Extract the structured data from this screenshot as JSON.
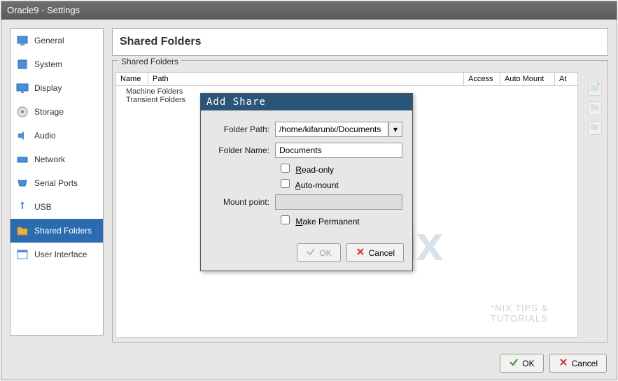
{
  "window": {
    "title": "Oracle9 - Settings"
  },
  "sidebar": {
    "items": [
      {
        "label": "General"
      },
      {
        "label": "System"
      },
      {
        "label": "Display"
      },
      {
        "label": "Storage"
      },
      {
        "label": "Audio"
      },
      {
        "label": "Network"
      },
      {
        "label": "Serial Ports"
      },
      {
        "label": "USB"
      },
      {
        "label": "Shared Folders"
      },
      {
        "label": "User Interface"
      }
    ]
  },
  "page": {
    "title": "Shared Folders",
    "groupbox_label": "Shared Folders",
    "columns": {
      "name": "Name",
      "path": "Path",
      "access": "Access",
      "automount": "Auto Mount",
      "at": "At"
    },
    "tree": {
      "machine": "Machine Folders",
      "transient": "Transient Folders"
    }
  },
  "dialog": {
    "title": "Add Share",
    "folder_path_label": "Folder Path:",
    "folder_path_value": "/home/kifarunix/Documents",
    "folder_name_label": "Folder Name:",
    "folder_name_value": "Documents",
    "readonly_label": "Read-only",
    "automount_label": "Auto-mount",
    "mountpoint_label": "Mount point:",
    "mountpoint_value": "",
    "permanent_label": "Make Permanent",
    "ok": "OK",
    "cancel": "Cancel"
  },
  "footer": {
    "ok": "OK",
    "cancel": "Cancel"
  },
  "watermark": {
    "main": "Kifarunix",
    "sub": "*NIX TIPS & TUTORIALS"
  }
}
